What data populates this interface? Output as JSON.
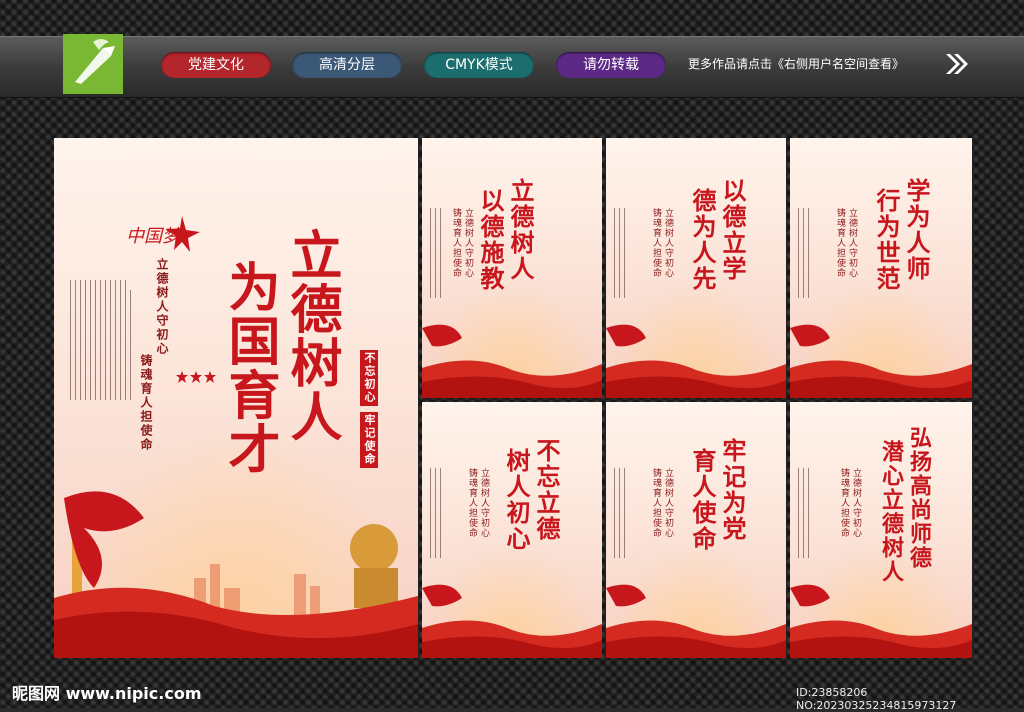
{
  "toolbar": {
    "tags": [
      "党建文化",
      "高清分层",
      "CMYK模式",
      "请勿转载"
    ],
    "tag_colors": [
      "#b3262c",
      "#3b5876",
      "#1c6e6e",
      "#5c2a86"
    ],
    "more_text": "更多作品请点击《右侧用户名空间查看》"
  },
  "main_poster": {
    "title_line1": "立德树人",
    "title_line2": "为国育才",
    "stamp1": "不忘初心",
    "stamp2": "牢记使命",
    "sub_line1": "立德树人守初心",
    "sub_line2": "铸魂育人担使命",
    "logo_text": "中国梦"
  },
  "posters": [
    {
      "line1": "立德树人",
      "line2": "以德施教"
    },
    {
      "line1": "以德立学",
      "line2": "德为人先"
    },
    {
      "line1": "学为人师",
      "line2": "行为世范"
    },
    {
      "line1": "不忘立德",
      "line2": "树人初心"
    },
    {
      "line1": "牢记为党",
      "line2": "育人使命"
    },
    {
      "line1": "弘扬高尚师德",
      "line2": "潜心立德树人"
    }
  ],
  "poster_sub": {
    "line1": "立德树人守初心",
    "line2": "铸魂育人担使命"
  },
  "watermark": {
    "left": "昵图网 www.nipic.com",
    "right": "ID:23858206 NO:20230325234815973127"
  }
}
